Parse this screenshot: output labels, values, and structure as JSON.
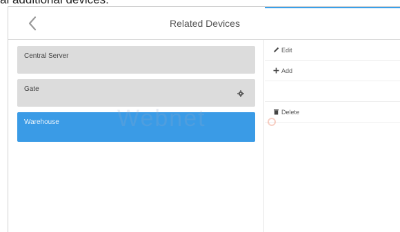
{
  "caption": "al additional devices:",
  "header": {
    "title": "Related Devices",
    "back_icon": "chevron-left-icon",
    "accent_color": "#39a0e9"
  },
  "devices": [
    {
      "label": "Central Server",
      "selected": false
    },
    {
      "label": "Gate",
      "selected": false,
      "icon": "gear-icon"
    },
    {
      "label": "Warehouse",
      "selected": true
    }
  ],
  "actions": [
    {
      "label": "Edit",
      "icon": "pencil-icon"
    },
    {
      "label": "Add",
      "icon": "plus-icon"
    },
    {
      "label": "Delete",
      "icon": "trash-icon"
    }
  ],
  "watermark": "Webnet",
  "colors": {
    "selected_row": "#3a9be6",
    "row": "#dcdcdc"
  }
}
